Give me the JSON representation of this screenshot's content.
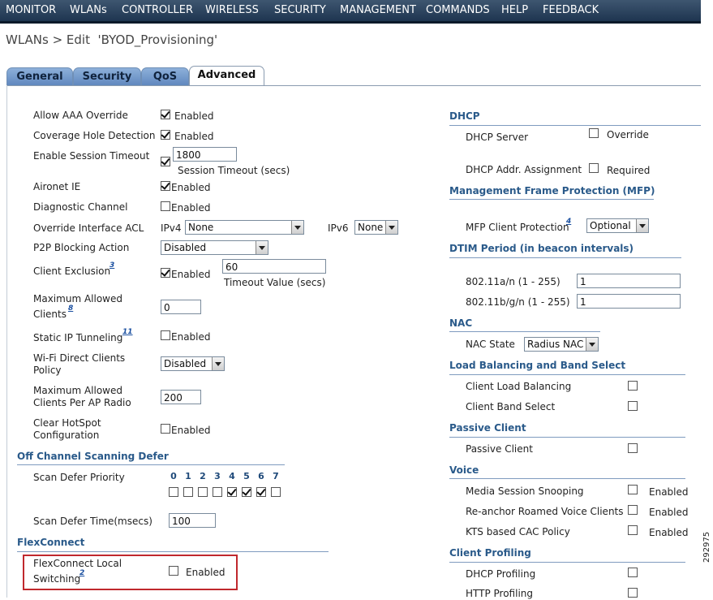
{
  "menu": {
    "items": [
      "MONITOR",
      "WLANs",
      "CONTROLLER",
      "WIRELESS",
      "SECURITY",
      "MANAGEMENT",
      "COMMANDS",
      "HELP",
      "FEEDBACK"
    ]
  },
  "page": {
    "title": "WLANs > Edit  'BYOD_Provisioning'"
  },
  "tabs": [
    "General",
    "Security",
    "QoS",
    "Advanced"
  ],
  "left": {
    "allow_aaa_override": {
      "label": "Allow AAA Override",
      "checked": true,
      "value": "Enabled"
    },
    "coverage_hole_detection": {
      "label": "Coverage Hole Detection",
      "checked": true,
      "value": "Enabled"
    },
    "session_timeout": {
      "label": "Enable Session Timeout",
      "checked": true,
      "input": "1800",
      "caption": "Session Timeout (secs)"
    },
    "aironet_ie": {
      "label": "Aironet IE",
      "checked": true,
      "value": "Enabled"
    },
    "diagnostic_channel": {
      "label": "Diagnostic Channel",
      "checked": false,
      "value": "Enabled"
    },
    "override_acl": {
      "label": "Override Interface ACL",
      "ipv4_label": "IPv4",
      "ipv4_value": "None",
      "ipv6_label": "IPv6",
      "ipv6_value": "None"
    },
    "p2p_blocking": {
      "label": "P2P Blocking Action",
      "value": "Disabled"
    },
    "client_exclusion": {
      "label": "Client Exclusion",
      "footnote": "3",
      "checked": true,
      "value": "Enabled",
      "input": "60",
      "caption": "Timeout Value (secs)"
    },
    "max_clients": {
      "label_line1": "Maximum Allowed",
      "label_line2": "Clients",
      "footnote": "8",
      "input": "0"
    },
    "static_ip_tunneling": {
      "label": "Static IP Tunneling",
      "footnote": "11",
      "checked": false,
      "value": "Enabled"
    },
    "wifi_direct": {
      "label_line1": "Wi-Fi Direct Clients",
      "label_line2": "Policy",
      "value": "Disabled"
    },
    "max_clients_per_radio": {
      "label_line1": "Maximum Allowed",
      "label_line2": "Clients Per AP Radio",
      "input": "200"
    },
    "clear_hotspot": {
      "label_line1": "Clear HotSpot",
      "label_line2": "Configuration",
      "checked": false,
      "value": "Enabled"
    },
    "off_channel_header": "Off Channel Scanning Defer",
    "scan_defer_priority": {
      "label": "Scan Defer Priority",
      "numbers": [
        "0",
        "1",
        "2",
        "3",
        "4",
        "5",
        "6",
        "7"
      ],
      "checked": [
        false,
        false,
        false,
        false,
        true,
        true,
        true,
        false
      ]
    },
    "scan_defer_time": {
      "label": "Scan Defer Time(msecs)",
      "input": "100"
    },
    "flexconnect_header": "FlexConnect",
    "flexconnect_local_switching": {
      "label_line1": "FlexConnect Local",
      "label_line2": "Switching",
      "footnote": "2",
      "checked": false,
      "value": "Enabled"
    }
  },
  "right": {
    "dhcp_header": "DHCP",
    "dhcp_server": {
      "label": "DHCP Server",
      "checked": false,
      "value": "Override"
    },
    "dhcp_addr_assignment": {
      "label": "DHCP Addr. Assignment",
      "checked": false,
      "value": "Required"
    },
    "mfp_header": "Management Frame Protection (MFP)",
    "mfp_client_protection": {
      "label": "MFP Client Protection",
      "footnote": "4",
      "value": "Optional"
    },
    "dtim_header": "DTIM Period (in beacon intervals)",
    "dtim_a_n": {
      "label": "802.11a/n (1 - 255)",
      "input": "1"
    },
    "dtim_b_g_n": {
      "label": "802.11b/g/n (1 - 255)",
      "input": "1"
    },
    "nac_header": "NAC",
    "nac_state": {
      "label": "NAC State",
      "value": "Radius NAC"
    },
    "lb_header": "Load Balancing and Band Select",
    "client_load_balancing": {
      "label": "Client Load Balancing",
      "checked": false
    },
    "client_band_select": {
      "label": "Client Band Select",
      "checked": false
    },
    "passive_header": "Passive Client",
    "passive_client": {
      "label": "Passive Client",
      "checked": false
    },
    "voice_header": "Voice",
    "media_session_snooping": {
      "label": "Media Session Snooping",
      "checked": false,
      "value": "Enabled"
    },
    "reanchor_voice": {
      "label": "Re-anchor Roamed Voice Clients",
      "checked": false,
      "value": "Enabled"
    },
    "kts_cac": {
      "label": "KTS based CAC Policy",
      "checked": false,
      "value": "Enabled"
    },
    "profiling_header": "Client Profiling",
    "dhcp_profiling": {
      "label": "DHCP Profiling",
      "checked": false
    },
    "http_profiling": {
      "label": "HTTP Profiling",
      "checked": false
    }
  },
  "figure_id": "292975"
}
